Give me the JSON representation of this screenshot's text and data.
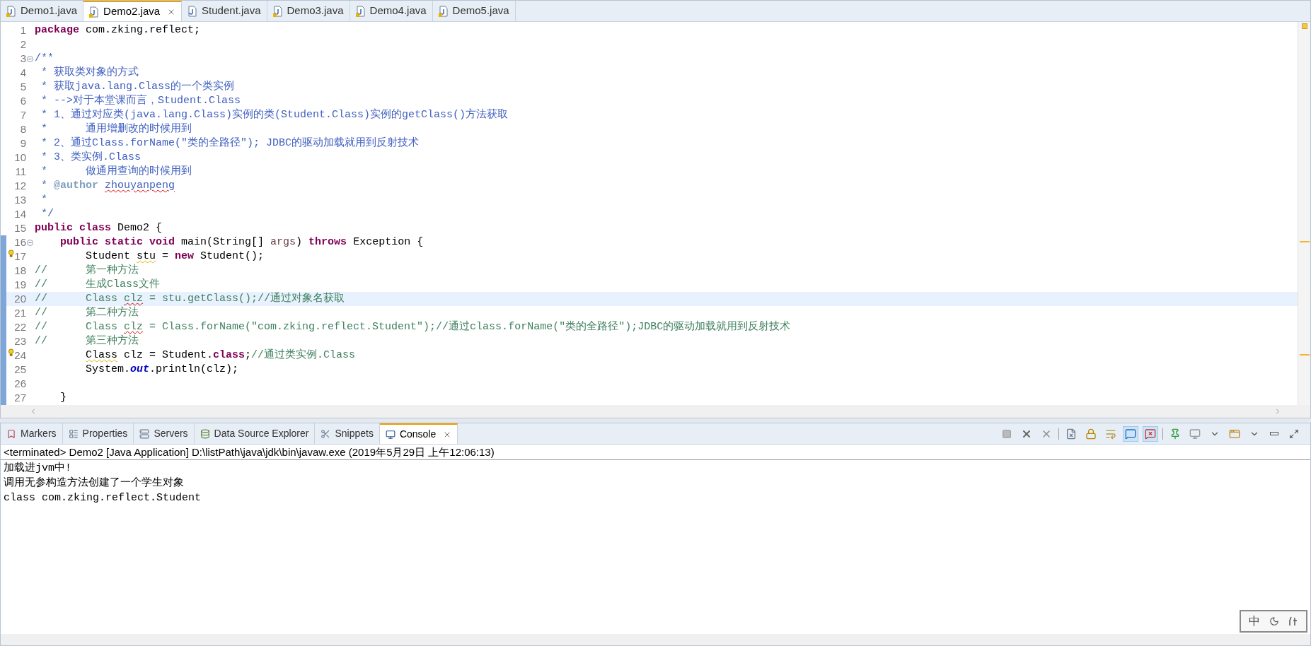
{
  "editor_tabs": [
    {
      "label": "Demo1.java",
      "selected": false,
      "closable": false,
      "kind": "warning"
    },
    {
      "label": "Demo2.java",
      "selected": true,
      "closable": true,
      "kind": "warning"
    },
    {
      "label": "Student.java",
      "selected": false,
      "closable": false,
      "kind": "plain"
    },
    {
      "label": "Demo3.java",
      "selected": false,
      "closable": false,
      "kind": "warning"
    },
    {
      "label": "Demo4.java",
      "selected": false,
      "closable": false,
      "kind": "warning"
    },
    {
      "label": "Demo5.java",
      "selected": false,
      "closable": false,
      "kind": "warning"
    }
  ],
  "code": {
    "lines": [
      {
        "number": "1",
        "segments": [
          {
            "text": "package",
            "kind": "keyword"
          },
          {
            "text": " com.zking.reflect;",
            "kind": "plain"
          }
        ]
      },
      {
        "number": "2"
      },
      {
        "number": "3",
        "fold": true,
        "segments": [
          {
            "text": "/**",
            "kind": "doc"
          }
        ]
      },
      {
        "number": "4",
        "segments": [
          {
            "text": " * 获取类对象的方式",
            "kind": "doc"
          }
        ]
      },
      {
        "number": "5",
        "segments": [
          {
            "text": " * 获取java.lang.Class的一个类实例",
            "kind": "doc"
          }
        ]
      },
      {
        "number": "6",
        "segments": [
          {
            "text": " * -->对于本堂课而言，Student.Class",
            "kind": "doc"
          }
        ]
      },
      {
        "number": "7",
        "segments": [
          {
            "text": " * 1、通过对应类(java.lang.Class)实例的类(Student.Class)实例的getClass()方法获取",
            "kind": "doc"
          }
        ]
      },
      {
        "number": "8",
        "segments": [
          {
            "text": " *      通用增删改的时候用到",
            "kind": "doc"
          }
        ]
      },
      {
        "number": "9",
        "segments": [
          {
            "text": " * 2、通过Class.forName(\"类的全路径\"); JDBC的驱动加载就用到反射技术",
            "kind": "doc"
          }
        ]
      },
      {
        "number": "10",
        "segments": [
          {
            "text": " * 3、类实例.Class",
            "kind": "doc"
          }
        ]
      },
      {
        "number": "11",
        "segments": [
          {
            "text": " *      做通用查询的时候用到",
            "kind": "doc"
          }
        ]
      },
      {
        "number": "12",
        "segments": [
          {
            "text": " * ",
            "kind": "doc"
          },
          {
            "text": "@author",
            "kind": "doctag"
          },
          {
            "text": " zhouyanpeng",
            "kind": "doc",
            "misspelled": true
          }
        ]
      },
      {
        "number": "13",
        "segments": [
          {
            "text": " *",
            "kind": "doc"
          }
        ]
      },
      {
        "number": "14",
        "segments": [
          {
            "text": " */",
            "kind": "doc"
          }
        ]
      },
      {
        "number": "15",
        "segments": [
          {
            "text": "public class",
            "kind": "keyword"
          },
          {
            "text": " Demo2 {",
            "kind": "plain"
          }
        ]
      },
      {
        "number": "16",
        "fold": true,
        "changed": true,
        "segments": [
          {
            "text": "    public static void",
            "kind": "keyword"
          },
          {
            "text": " main(String[] ",
            "kind": "plain"
          },
          {
            "text": "args",
            "kind": "param"
          },
          {
            "text": ") ",
            "kind": "plain"
          },
          {
            "text": "throws",
            "kind": "keyword"
          },
          {
            "text": " Exception {",
            "kind": "plain"
          }
        ]
      },
      {
        "number": "17",
        "changed": true,
        "warning": true,
        "segments": [
          {
            "text": "        Student ",
            "kind": "plain"
          },
          {
            "text": "stu",
            "kind": "plain",
            "warning": true
          },
          {
            "text": " = ",
            "kind": "plain"
          },
          {
            "text": "new",
            "kind": "keyword"
          },
          {
            "text": " Student();",
            "kind": "plain"
          }
        ]
      },
      {
        "number": "18",
        "changed": true,
        "segments": [
          {
            "text": "//      第一种方法",
            "kind": "comment"
          }
        ]
      },
      {
        "number": "19",
        "changed": true,
        "segments": [
          {
            "text": "//      生成Class文件",
            "kind": "comment"
          }
        ]
      },
      {
        "number": "20",
        "changed": true,
        "current": true,
        "segments": [
          {
            "text": "//      Class ",
            "kind": "comment"
          },
          {
            "text": "clz",
            "kind": "comment",
            "misspelled": true
          },
          {
            "text": " = stu.getClass();//通过对象名获取",
            "kind": "comment"
          }
        ]
      },
      {
        "number": "21",
        "changed": true,
        "segments": [
          {
            "text": "//      第二种方法",
            "kind": "comment"
          }
        ]
      },
      {
        "number": "22",
        "changed": true,
        "segments": [
          {
            "text": "//      Class ",
            "kind": "comment"
          },
          {
            "text": "clz",
            "kind": "comment",
            "misspelled": true
          },
          {
            "text": " = Class.forName(\"com.zking.reflect.Student\");//通过class.forName(\"类的全路径\");JDBC的驱动加载就用到反射技术",
            "kind": "comment"
          }
        ]
      },
      {
        "number": "23",
        "changed": true,
        "segments": [
          {
            "text": "//      第三种方法",
            "kind": "comment"
          }
        ]
      },
      {
        "number": "24",
        "changed": true,
        "warning": true,
        "segments": [
          {
            "text": "        Class",
            "kind": "plain",
            "warning": true
          },
          {
            "text": " clz = Student.",
            "kind": "plain"
          },
          {
            "text": "class",
            "kind": "keyword"
          },
          {
            "text": ";",
            "kind": "plain"
          },
          {
            "text": "//通过类实例.Class",
            "kind": "comment"
          }
        ]
      },
      {
        "number": "25",
        "changed": true,
        "segments": [
          {
            "text": "        System.",
            "kind": "plain"
          },
          {
            "text": "out",
            "kind": "static_field"
          },
          {
            "text": ".println(clz);",
            "kind": "plain"
          }
        ]
      },
      {
        "number": "26",
        "changed": true
      },
      {
        "number": "27",
        "changed": true,
        "segments": [
          {
            "text": "    }",
            "kind": "plain"
          }
        ]
      }
    ]
  },
  "view_tabs": [
    {
      "label": "Markers",
      "selected": false,
      "closable": false,
      "kind": "markers"
    },
    {
      "label": "Properties",
      "selected": false,
      "closable": false,
      "kind": "properties"
    },
    {
      "label": "Servers",
      "selected": false,
      "closable": false,
      "kind": "servers"
    },
    {
      "label": "Data Source Explorer",
      "selected": false,
      "closable": false,
      "kind": "datasource"
    },
    {
      "label": "Snippets",
      "selected": false,
      "closable": false,
      "kind": "snippets"
    },
    {
      "label": "Console",
      "selected": true,
      "closable": true,
      "kind": "console"
    }
  ],
  "console_toolbar": [
    {
      "kind": "terminate"
    },
    {
      "kind": "remove"
    },
    {
      "kind": "remove_all"
    },
    {
      "kind": "separator"
    },
    {
      "kind": "clear"
    },
    {
      "kind": "scroll_lock",
      "pressed": false
    },
    {
      "kind": "word_wrap",
      "pressed": false
    },
    {
      "kind": "show_stdout",
      "pressed": true
    },
    {
      "kind": "show_stderr",
      "pressed": true
    },
    {
      "kind": "separator"
    },
    {
      "kind": "pin",
      "pressed": false
    },
    {
      "kind": "display"
    },
    {
      "kind": "dropdown"
    },
    {
      "kind": "new_console"
    },
    {
      "kind": "dropdown"
    },
    {
      "kind": "minimize"
    },
    {
      "kind": "maximize"
    }
  ],
  "console": {
    "header": "<terminated> Demo2 [Java Application] D:\\listPath\\java\\jdk\\bin\\javaw.exe (2019年5月29日 上午12:06:13)",
    "output": [
      "加载进jvm中!",
      "调用无参构造方法创建了一个学生对象",
      "class com.zking.reflect.Student"
    ]
  },
  "ime_bar": {
    "mode": "中"
  }
}
